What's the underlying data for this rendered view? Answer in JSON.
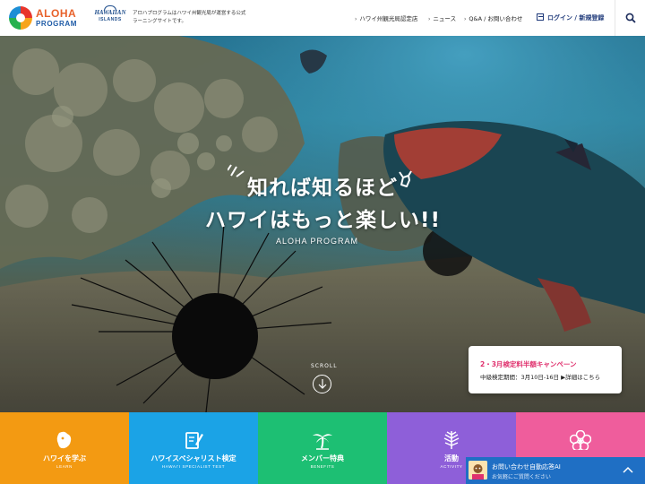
{
  "header": {
    "logo_line1": "ALOHA",
    "logo_line2": "PROGRAM",
    "partner_logo_top": "HAWAIIAN",
    "partner_logo_sub": "ISLANDS",
    "description": "アロハプログラムはハワイ州観光局が運営する公式ラーニングサイトです。",
    "nav": [
      {
        "label": "ハワイ州観光局認定店"
      },
      {
        "label": "ニュース"
      },
      {
        "label": "Q&A / お問い合わせ"
      }
    ],
    "login_label": "ログイン / 新規登録"
  },
  "hero": {
    "headline_line1": "知れば知るほど",
    "headline_line2": "ハワイはもっと楽しい!!",
    "brand": "ALOHA PROGRAM",
    "scroll_label": "SCROLL"
  },
  "campaign": {
    "title": "2・3月検定料半額キャンペーン",
    "detail": "中級検定期間：3月10日-16日 ▶詳細はこちら"
  },
  "tiles": [
    {
      "label": "ハワイを学ぶ",
      "sub": "LEARN",
      "color": "#f39a12",
      "icon": "hawaii-island-icon"
    },
    {
      "label": "ハワイスペシャリスト検定",
      "sub": "HAWAI'I SPECIALIST TEST",
      "color": "#1ba3e6",
      "icon": "test-pen-icon"
    },
    {
      "label": "メンバー特典",
      "sub": "BENEFITS",
      "color": "#1dbf73",
      "icon": "palm-tree-icon"
    },
    {
      "label": "活動",
      "sub": "ACTIVITY",
      "color": "#8e5fd9",
      "icon": "fern-icon"
    },
    {
      "label": "",
      "sub": "",
      "color": "#ef5d9c",
      "icon": "hibiscus-icon"
    }
  ],
  "chat": {
    "title": "お問い合わせ自動応答AI",
    "subtitle": "お気軽にご質問ください"
  },
  "colors": {
    "brand_orange": "#e8622b",
    "brand_blue": "#1d5aa6",
    "campaign_pink": "#e0316e",
    "chat_blue": "#1f6fc4"
  }
}
